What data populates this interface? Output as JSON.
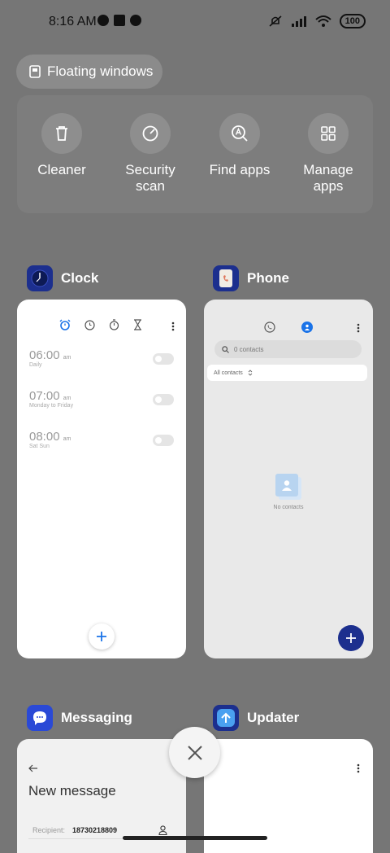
{
  "status_bar": {
    "time": "8:16 AM",
    "battery": "100"
  },
  "floating_windows": {
    "label": "Floating windows"
  },
  "tools": [
    {
      "label": "Cleaner",
      "icon": "trash-icon"
    },
    {
      "label": "Security\nscan",
      "icon": "security-scan-icon"
    },
    {
      "label": "Find apps",
      "icon": "find-apps-icon"
    },
    {
      "label": "Manage\napps",
      "icon": "grid-icon"
    }
  ],
  "apps": {
    "clock": {
      "name": "Clock",
      "alarms": [
        {
          "time": "06:00",
          "ampm": "am",
          "repeat": "Daily"
        },
        {
          "time": "07:00",
          "ampm": "am",
          "repeat": "Monday to Friday"
        },
        {
          "time": "08:00",
          "ampm": "am",
          "repeat": "Sat Sun"
        }
      ]
    },
    "phone": {
      "name": "Phone",
      "search_placeholder": "0 contacts",
      "filter": "All contacts",
      "empty_text": "No contacts"
    },
    "messaging": {
      "name": "Messaging",
      "title": "New message",
      "recipient_label": "Recipient:",
      "recipient_value": "18730218809"
    },
    "updater": {
      "name": "Updater"
    }
  },
  "colors": {
    "accent": "#1a73e8",
    "phone_fab": "#1c2f8e",
    "background": "#767676"
  }
}
